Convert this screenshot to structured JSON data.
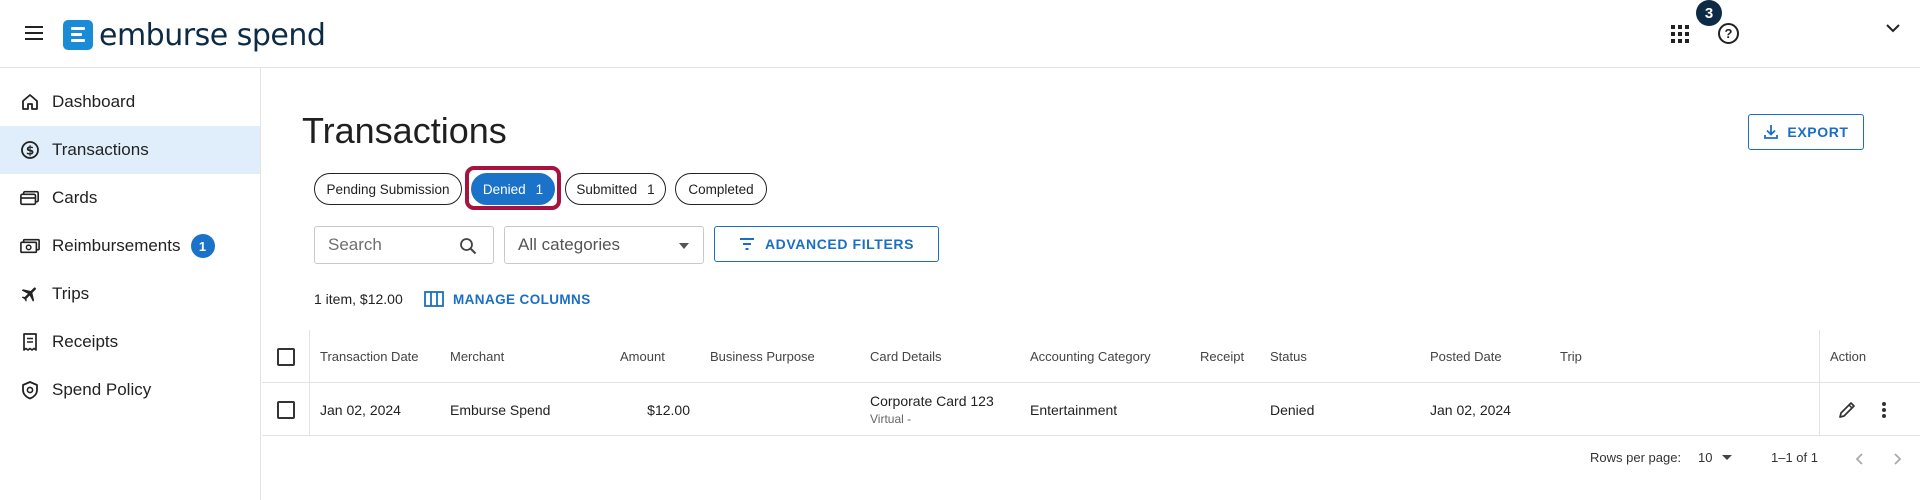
{
  "header": {
    "logo_text": "emburse spend",
    "notification_count": "3",
    "help_glyph": "?",
    "brand_color": "#1a8bd6"
  },
  "sidebar": {
    "items": [
      {
        "label": "Dashboard",
        "icon": "home-icon"
      },
      {
        "label": "Transactions",
        "icon": "dollar-circle-icon",
        "active": true
      },
      {
        "label": "Cards",
        "icon": "cards-icon"
      },
      {
        "label": "Reimbursements",
        "icon": "cash-icon",
        "badge": "1"
      },
      {
        "label": "Trips",
        "icon": "airplane-icon"
      },
      {
        "label": "Receipts",
        "icon": "receipt-icon"
      },
      {
        "label": "Spend Policy",
        "icon": "shield-icon"
      }
    ],
    "active_color": "#dfeefa"
  },
  "main": {
    "title": "Transactions",
    "export_label": "EXPORT",
    "chips": [
      {
        "label": "Pending Submission",
        "count": ""
      },
      {
        "label": "Denied",
        "count": "1",
        "selected": true
      },
      {
        "label": "Submitted",
        "count": "1"
      },
      {
        "label": "Completed",
        "count": ""
      }
    ],
    "search_placeholder": "Search",
    "category_value": "All categories",
    "advanced_filters_label": "ADVANCED FILTERS",
    "summary": "1 item, $12.00",
    "manage_columns_label": "MANAGE COLUMNS",
    "accent_color": "#1a6fc4",
    "highlight_color": "#a7133e"
  },
  "table": {
    "columns": [
      "Transaction Date",
      "Merchant",
      "Amount",
      "Business Purpose",
      "Card Details",
      "Accounting Category",
      "Receipt",
      "Status",
      "Posted Date",
      "Trip",
      "Action"
    ],
    "rows": [
      {
        "transaction_date": "Jan 02, 2024",
        "merchant": "Emburse Spend",
        "amount": "$12.00",
        "business_purpose": "",
        "card": "Corporate Card 123",
        "card_sub": "Virtual -",
        "accounting_category": "Entertainment",
        "receipt": "",
        "status": "Denied",
        "posted_date": "Jan 02, 2024",
        "trip": ""
      }
    ]
  },
  "pagination": {
    "rows_per_page_label": "Rows per page:",
    "rows_per_page_value": "10",
    "range": "1–1 of 1"
  }
}
